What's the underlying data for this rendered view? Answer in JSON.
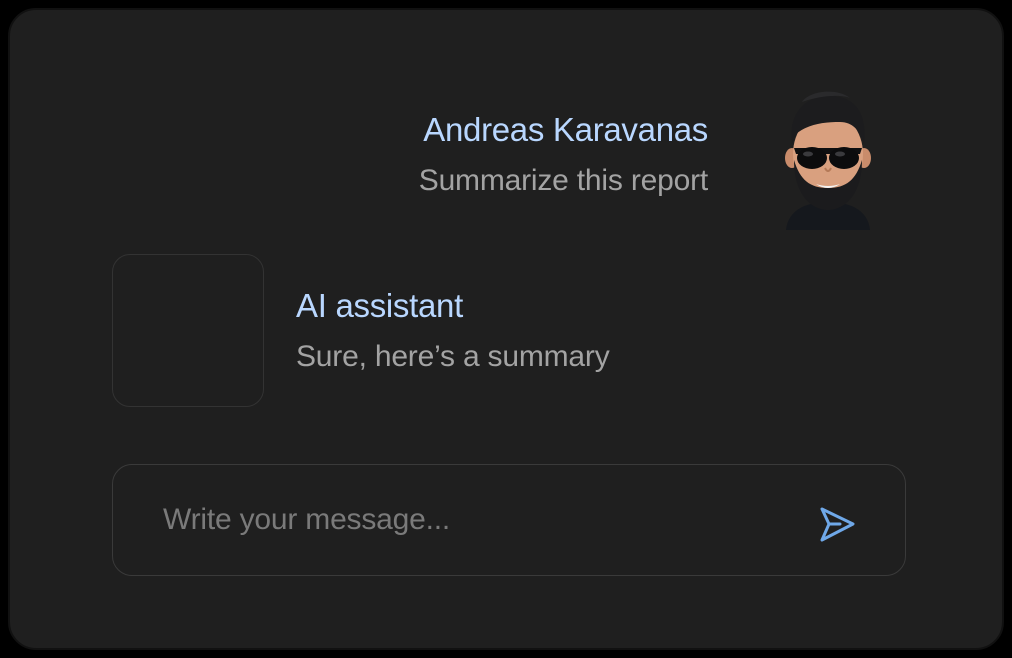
{
  "user_message": {
    "sender": "Andreas Karavanas",
    "text": "Summarize this report"
  },
  "assistant_message": {
    "sender": "AI assistant",
    "text": "Sure, here’s a summary"
  },
  "composer": {
    "placeholder": "Write your message...",
    "value": "",
    "send_icon": "send-icon"
  },
  "colors": {
    "background": "#1f1f1f",
    "sender_name": "#b9d7ff",
    "message_text": "#a3a3a3",
    "accent": "#6fa8e8"
  }
}
